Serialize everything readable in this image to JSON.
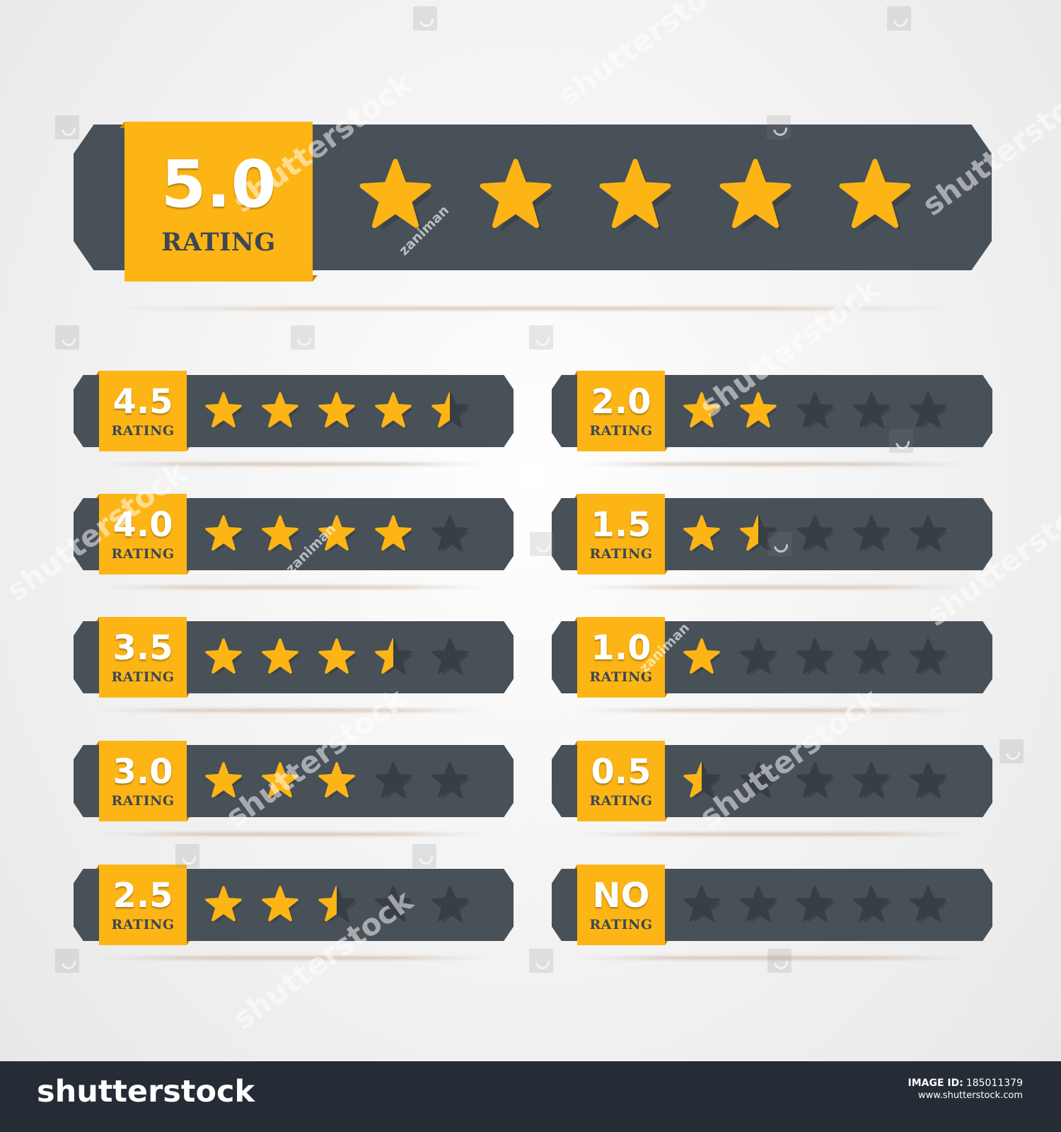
{
  "ratings": [
    {
      "value_label": "5.0",
      "rating_label": "RATING",
      "stars": 5
    },
    {
      "value_label": "4.5",
      "rating_label": "RATING",
      "stars": 4.5
    },
    {
      "value_label": "4.0",
      "rating_label": "RATING",
      "stars": 4
    },
    {
      "value_label": "3.5",
      "rating_label": "RATING",
      "stars": 3.5
    },
    {
      "value_label": "3.0",
      "rating_label": "RATING",
      "stars": 3
    },
    {
      "value_label": "2.5",
      "rating_label": "RATING",
      "stars": 2.5
    },
    {
      "value_label": "2.0",
      "rating_label": "RATING",
      "stars": 2
    },
    {
      "value_label": "1.5",
      "rating_label": "RATING",
      "stars": 1.5
    },
    {
      "value_label": "1.0",
      "rating_label": "RATING",
      "stars": 1
    },
    {
      "value_label": "0.5",
      "rating_label": "RATING",
      "stars": 0.5
    },
    {
      "value_label": "NO",
      "rating_label": "RATING",
      "stars": 0
    }
  ],
  "footer": {
    "logo_text": "shutterstock",
    "image_id_label": "IMAGE ID:",
    "image_id": "185011379",
    "url": "www.shutterstock.com"
  },
  "watermarks": {
    "shutterstock": "shutterstock",
    "zaniman": "zaniman"
  },
  "colors": {
    "background": "#f1f1f1",
    "bar": "#485058",
    "badge": "#fdb515",
    "badge_text": "#ffffff",
    "rating_text": "#3c4752",
    "star_filled": "#fdb515",
    "star_empty": "#373e45",
    "footer": "#252c35"
  }
}
